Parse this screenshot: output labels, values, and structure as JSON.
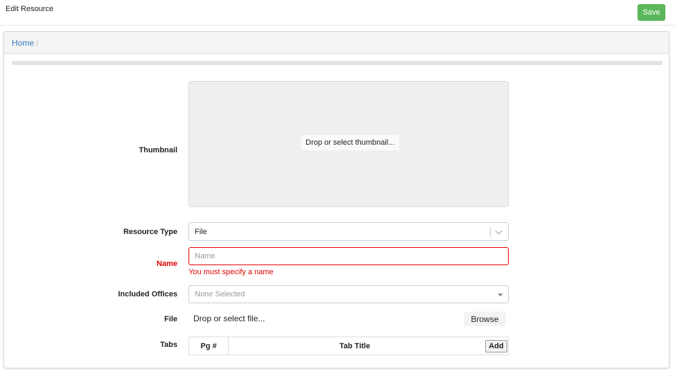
{
  "header": {
    "title": "Edit Resource",
    "save_label": "Save"
  },
  "breadcrumb": {
    "home": "Home",
    "separator": "/"
  },
  "progress": {
    "value_percent": 100
  },
  "form": {
    "thumbnail": {
      "label": "Thumbnail",
      "dropzone_text": "Drop or select thumbnail..."
    },
    "resource_type": {
      "label": "Resource Type",
      "value": "File"
    },
    "name": {
      "label": "Name",
      "value": "",
      "placeholder": "Name",
      "error": "You must specify a name"
    },
    "included_offices": {
      "label": "Included Offices",
      "value": "None Selected"
    },
    "file": {
      "label": "File",
      "text": "Drop or select file...",
      "browse_label": "Browse"
    },
    "tabs": {
      "label": "Tabs",
      "columns": [
        "Pg #",
        "Tab Title"
      ],
      "add_label": "Add",
      "rows": []
    }
  },
  "colors": {
    "save": "#5cb85c",
    "error": "#e00000",
    "link": "#337ab7"
  },
  "icons": {
    "resource_type_dropdown": "chevron-down-icon",
    "offices_dropdown": "caret-down-icon"
  }
}
